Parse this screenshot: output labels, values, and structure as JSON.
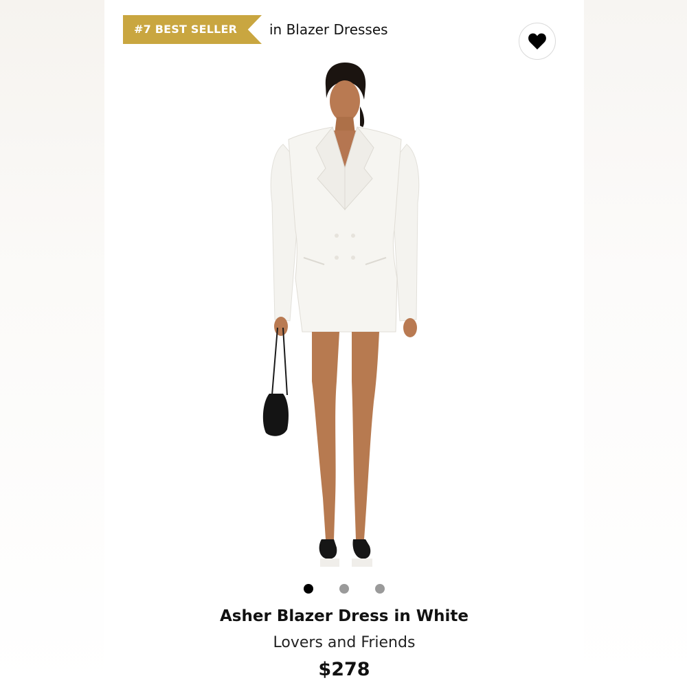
{
  "badge": {
    "text": "#7 BEST SELLER",
    "color": "#c9a640"
  },
  "category": {
    "text": "in Blazer Dresses"
  },
  "favorite": {
    "icon": "heart-icon"
  },
  "gallery": {
    "image_count": 3,
    "active_index": 0
  },
  "product": {
    "title": "Asher Blazer Dress in White",
    "brand": "Lovers and Friends",
    "price": "$278"
  }
}
